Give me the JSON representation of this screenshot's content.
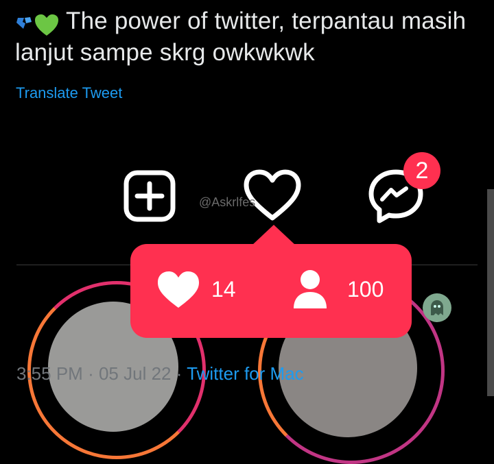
{
  "tweet": {
    "icons": [
      "broken-heart-icon",
      "green-heart-icon"
    ],
    "text": "The power of twitter, terpantau masih lanjut sampe skrg owkwkwk",
    "translate_label": "Translate Tweet"
  },
  "image": {
    "watermark": "@Askrlfes",
    "messenger_badge": "2",
    "likes_count": "14",
    "followers_count": "100"
  },
  "footer": {
    "time": "3:55 PM",
    "separator": "·",
    "date": "05 Jul 22",
    "source": "Twitter for Mac"
  },
  "colors": {
    "accent": "#1d9bf0",
    "notification": "#ff3050",
    "background": "#000000",
    "muted": "#71767b"
  }
}
